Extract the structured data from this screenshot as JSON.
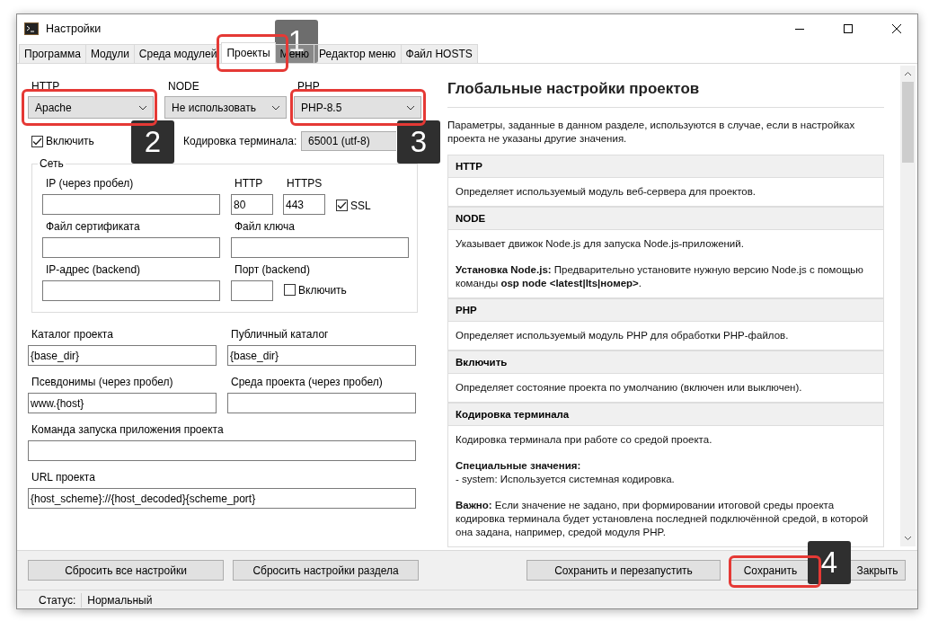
{
  "window": {
    "title": "Настройки"
  },
  "tabs": [
    {
      "label": "Программа",
      "selected": false
    },
    {
      "label": "Модули",
      "selected": false
    },
    {
      "label": "Среда модулей",
      "selected": false
    },
    {
      "label": "Проекты",
      "selected": true
    },
    {
      "label": "Меню",
      "selected": false
    },
    {
      "label": "Редактор меню",
      "selected": false
    },
    {
      "label": "Файл HOSTS",
      "selected": false
    }
  ],
  "modules": [
    {
      "label": "HTTP",
      "value": "Apache"
    },
    {
      "label": "NODE",
      "value": "Не использовать"
    },
    {
      "label": "PHP",
      "value": "PHP-8.5"
    }
  ],
  "enable": {
    "label": "Включить",
    "checked": true
  },
  "terminal_encoding": {
    "label": "Кодировка терминала:",
    "value": "65001 (utf-8)"
  },
  "network": {
    "legend": "Сеть",
    "ip": {
      "label": "IP (через пробел)"
    },
    "http": {
      "label": "HTTP",
      "value": "80"
    },
    "https": {
      "label": "HTTPS",
      "value": "443"
    },
    "ssl": {
      "label": "SSL",
      "checked": true
    },
    "cert": {
      "label": "Файл сертификата"
    },
    "key": {
      "label": "Файл ключа"
    },
    "backend_ip": {
      "label": "IP-адрес (backend)"
    },
    "backend_port": {
      "label": "Порт (backend)"
    },
    "backend_enable": {
      "label": "Включить",
      "checked": false
    }
  },
  "fields": [
    {
      "label": "Каталог проекта",
      "value": "{base_dir}",
      "wide": false
    },
    {
      "label": "Публичный каталог",
      "value": "{base_dir}",
      "wide": false
    },
    {
      "label": "Псевдонимы (через пробел)",
      "value": "www.{host}",
      "wide": false
    },
    {
      "label": "Среда проекта (через пробел)",
      "wide": false
    },
    {
      "label": "Команда запуска приложения проекта",
      "wide": true
    },
    {
      "label": "URL проекта",
      "value": "{host_scheme}://{host_decoded}{scheme_port}",
      "wide": true
    }
  ],
  "help": {
    "title": "Глобальные настройки проектов",
    "intro": "Параметры, заданные в данном разделе, используются в случае, если в настройках проекта не указаны другие значения.",
    "sections": [
      {
        "title": "HTTP",
        "paragraphs": [
          [
            "Определяет используемый модуль веб-сервера для проектов."
          ]
        ]
      },
      {
        "title": "NODE",
        "paragraphs": [
          [
            "Указывает движок Node.js для запуска Node.js-приложений."
          ],
          [
            "**Установка Node.js:** Предварительно установите нужную версию Node.js с помощью команды **osp node <latest|lts|номер>**."
          ]
        ]
      },
      {
        "title": "PHP",
        "paragraphs": [
          [
            "Определяет используемый модуль PHP для обработки PHP-файлов."
          ]
        ]
      },
      {
        "title": "Включить",
        "paragraphs": [
          [
            "Определяет состояние проекта по умолчанию (включен или выключен)."
          ]
        ]
      },
      {
        "title": "Кодировка терминала",
        "paragraphs": [
          [
            "Кодировка терминала при работе со средой проекта."
          ],
          [
            "**Специальные значения:**",
            "- system: Используется системная кодировка."
          ],
          [
            "**Важно:** Если значение не задано, при формировании итоговой среды проекта кодировка терминала будет установлена последней подключённой средой, в которой она задана, например, средой модуля PHP."
          ]
        ]
      }
    ]
  },
  "buttons_left": [
    "Сбросить все настройки",
    "Сбросить настройки раздела"
  ],
  "buttons_right": [
    "Сохранить и перезапустить",
    "Сохранить",
    "Закрыть"
  ],
  "status_bar": {
    "label": "Статус:",
    "value": "Нормальный"
  },
  "annotations": [
    {
      "number": "1"
    },
    {
      "number": "2"
    },
    {
      "number": "3"
    },
    {
      "number": "4"
    }
  ]
}
